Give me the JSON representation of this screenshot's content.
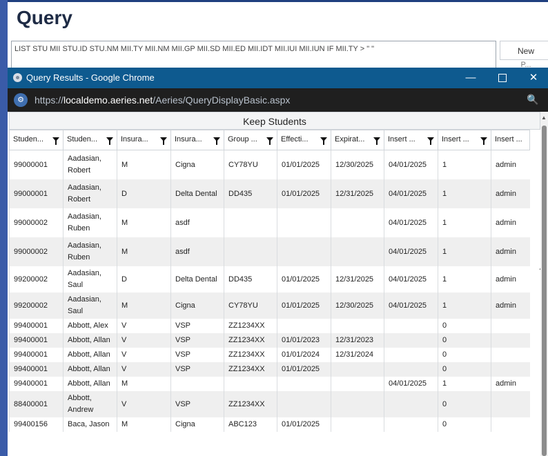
{
  "page": {
    "title": "Query",
    "query_text": "LIST STU MII STU.ID STU.NM MII.TY MII.NM MII.GP MII.SD MII.ED MII.IDT MII.IUI MII.IUN IF MII.TY > \" \"",
    "new_label": "New",
    "hidden_label": "P..."
  },
  "window": {
    "title": "Query Results - Google Chrome",
    "url_prefix": "https://",
    "url_host": "localdemo.aeries.net",
    "url_path": "/Aeries/QueryDisplayBasic.aspx",
    "minimize": "—",
    "close": "✕"
  },
  "grid": {
    "group_label": "Keep Students",
    "columns": [
      "Studen...",
      "Studen...",
      "Insura...",
      "Insura...",
      "Group ...",
      "Effecti...",
      "Expirat...",
      "Insert ...",
      "Insert ...",
      "Insert ..."
    ],
    "rows": [
      [
        "99000001",
        "Aadasian, Robert",
        "M",
        "Cigna",
        "CY78YU",
        "01/01/2025",
        "12/30/2025",
        "04/01/2025",
        "1",
        "admin"
      ],
      [
        "99000001",
        "Aadasian, Robert",
        "D",
        "Delta Dental",
        "DD435",
        "01/01/2025",
        "12/31/2025",
        "04/01/2025",
        "1",
        "admin"
      ],
      [
        "99000002",
        "Aadasian, Ruben",
        "M",
        "asdf",
        "",
        "",
        "",
        "04/01/2025",
        "1",
        "admin"
      ],
      [
        "99000002",
        "Aadasian, Ruben",
        "M",
        "asdf",
        "",
        "",
        "",
        "04/01/2025",
        "1",
        "admin"
      ],
      [
        "99200002",
        "Aadasian, Saul",
        "D",
        "Delta Dental",
        "DD435",
        "01/01/2025",
        "12/31/2025",
        "04/01/2025",
        "1",
        "admin"
      ],
      [
        "99200002",
        "Aadasian, Saul",
        "M",
        "Cigna",
        "CY78YU",
        "01/01/2025",
        "12/30/2025",
        "04/01/2025",
        "1",
        "admin"
      ],
      [
        "99400001",
        "Abbott, Alex",
        "V",
        "VSP",
        "ZZ1234XX",
        "",
        "",
        "",
        "0",
        ""
      ],
      [
        "99400001",
        "Abbott, Allan",
        "V",
        "VSP",
        "ZZ1234XX",
        "01/01/2023",
        "12/31/2023",
        "",
        "0",
        ""
      ],
      [
        "99400001",
        "Abbott, Allan",
        "V",
        "VSP",
        "ZZ1234XX",
        "01/01/2024",
        "12/31/2024",
        "",
        "0",
        ""
      ],
      [
        "99400001",
        "Abbott, Allan",
        "V",
        "VSP",
        "ZZ1234XX",
        "01/01/2025",
        "",
        "",
        "0",
        ""
      ],
      [
        "99400001",
        "Abbott, Allan",
        "M",
        "",
        "",
        "",
        "",
        "04/01/2025",
        "1",
        "admin"
      ],
      [
        "88400001",
        "Abbott, Andrew",
        "V",
        "VSP",
        "ZZ1234XX",
        "",
        "",
        "",
        "0",
        ""
      ],
      [
        "99400156",
        "Baca, Jason",
        "M",
        "Cigna",
        "ABC123",
        "01/01/2025",
        "",
        "",
        "0",
        ""
      ]
    ]
  }
}
